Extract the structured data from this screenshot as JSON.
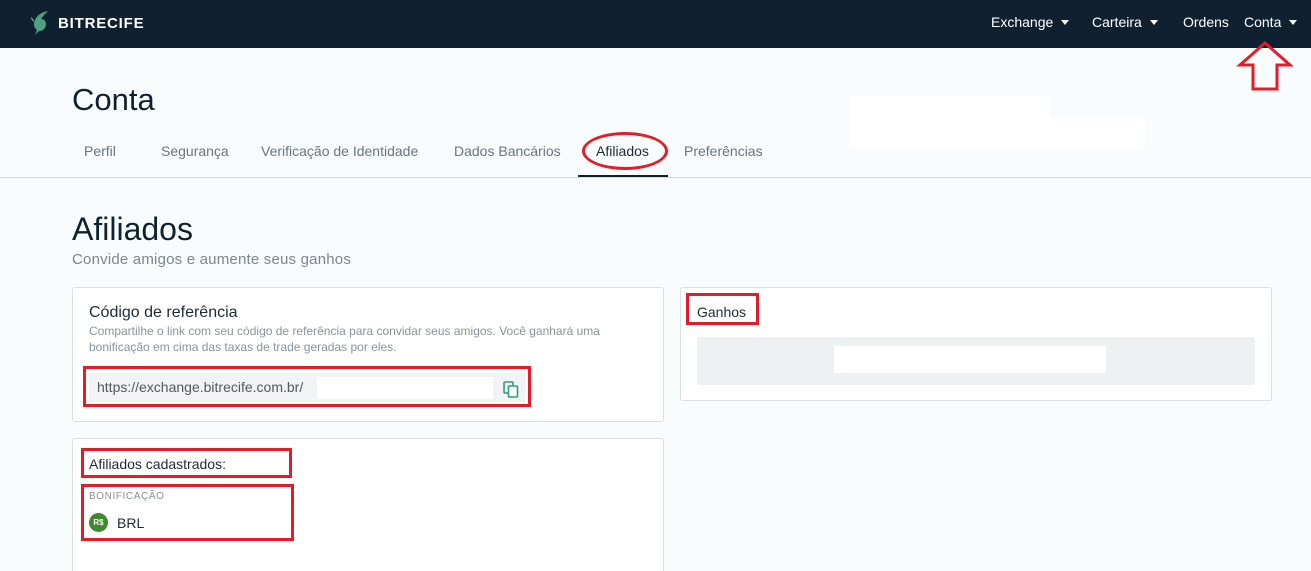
{
  "brand": {
    "name": "BITRECIFE",
    "logo_icon": "fish-logo-icon",
    "color": "#0f2131"
  },
  "nav": [
    {
      "label": "Exchange",
      "dropdown": true
    },
    {
      "label": "Carteira",
      "dropdown": true
    },
    {
      "label": "Ordens",
      "dropdown": false
    },
    {
      "label": "Conta",
      "dropdown": true
    }
  ],
  "page": {
    "title": "Conta"
  },
  "tabs": [
    {
      "label": "Perfil"
    },
    {
      "label": "Segurança"
    },
    {
      "label": "Verificação de Identidade"
    },
    {
      "label": "Dados Bancários"
    },
    {
      "label": "Afiliados",
      "active": true
    },
    {
      "label": "Preferências"
    }
  ],
  "section": {
    "title": "Afiliados",
    "subtitle": "Convide amigos e aumente seus ganhos"
  },
  "referral": {
    "title": "Código de referência",
    "description": "Compartilhe o link com seu código de referência para convidar seus amigos. Você ganhará uma bonificação em cima das taxas de trade geradas por eles.",
    "url": "https://exchange.bitrecife.com.br/",
    "copy_icon": "copy-icon"
  },
  "gains": {
    "title": "Ganhos"
  },
  "affiliates": {
    "title": "Afiliados cadastrados:",
    "bonus_label": "BONIFICAÇÃO",
    "currency_symbol": "R$",
    "currency_name": "BRL",
    "currency_color": "#3f8a2d"
  },
  "annotation": {
    "color": "#e11d2a"
  }
}
